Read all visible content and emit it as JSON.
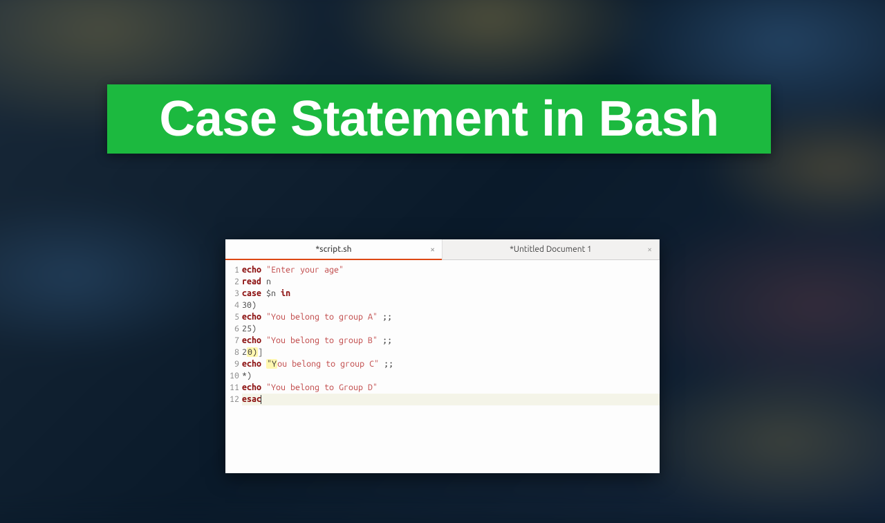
{
  "banner": {
    "title": "Case Statement in Bash"
  },
  "editor": {
    "tabs": [
      {
        "label": "*script.sh",
        "active": true
      },
      {
        "label": "*Untitled Document 1",
        "active": false
      }
    ],
    "lines": [
      {
        "n": "1",
        "tokens": [
          {
            "t": "kw",
            "v": "echo"
          },
          {
            "t": "sp",
            "v": " "
          },
          {
            "t": "str",
            "v": "\"Enter your age\""
          }
        ]
      },
      {
        "n": "2",
        "tokens": [
          {
            "t": "kw",
            "v": "read"
          },
          {
            "t": "sp",
            "v": " "
          },
          {
            "t": "op",
            "v": "n"
          }
        ]
      },
      {
        "n": "3",
        "tokens": [
          {
            "t": "kw",
            "v": "case"
          },
          {
            "t": "sp",
            "v": " "
          },
          {
            "t": "op",
            "v": "$n "
          },
          {
            "t": "kw",
            "v": "in"
          }
        ]
      },
      {
        "n": "4",
        "tokens": [
          {
            "t": "op",
            "v": "30)"
          }
        ]
      },
      {
        "n": "5",
        "tokens": [
          {
            "t": "kw",
            "v": "echo"
          },
          {
            "t": "sp",
            "v": " "
          },
          {
            "t": "str",
            "v": "\"You belong to group A\""
          },
          {
            "t": "sp",
            "v": " "
          },
          {
            "t": "op",
            "v": ";;"
          }
        ]
      },
      {
        "n": "6",
        "tokens": [
          {
            "t": "op",
            "v": "25)"
          }
        ]
      },
      {
        "n": "7",
        "tokens": [
          {
            "t": "kw",
            "v": "echo"
          },
          {
            "t": "sp",
            "v": " "
          },
          {
            "t": "str",
            "v": "\"You belong to group B\""
          },
          {
            "t": "sp",
            "v": " "
          },
          {
            "t": "op",
            "v": ";;"
          }
        ]
      },
      {
        "n": "8",
        "tokens": [
          {
            "t": "op",
            "v": "2"
          },
          {
            "t": "hl",
            "v": "0)"
          },
          {
            "t": "op",
            "v": "|"
          }
        ],
        "hlNote": "cursor after paren"
      },
      {
        "n": "9",
        "tokens": [
          {
            "t": "kw",
            "v": "echo"
          },
          {
            "t": "sp",
            "v": " "
          },
          {
            "t": "hl",
            "v": "\"Y"
          },
          {
            "t": "str",
            "v": "ou belong to group C\""
          },
          {
            "t": "sp",
            "v": " "
          },
          {
            "t": "op",
            "v": ";;"
          }
        ]
      },
      {
        "n": "10",
        "tokens": [
          {
            "t": "op",
            "v": "*)"
          }
        ]
      },
      {
        "n": "11",
        "tokens": [
          {
            "t": "kw",
            "v": "echo"
          },
          {
            "t": "sp",
            "v": " "
          },
          {
            "t": "str",
            "v": "\"You belong to Group D\""
          }
        ]
      },
      {
        "n": "12",
        "tokens": [
          {
            "t": "kw",
            "v": "esac"
          }
        ],
        "current": true,
        "cursorAfter": true
      }
    ]
  },
  "colors": {
    "banner_bg": "#1cb93f",
    "banner_fg": "#ffffff",
    "tab_accent": "#dd4814",
    "keyword": "#8b0e0e",
    "string": "#c04848"
  }
}
